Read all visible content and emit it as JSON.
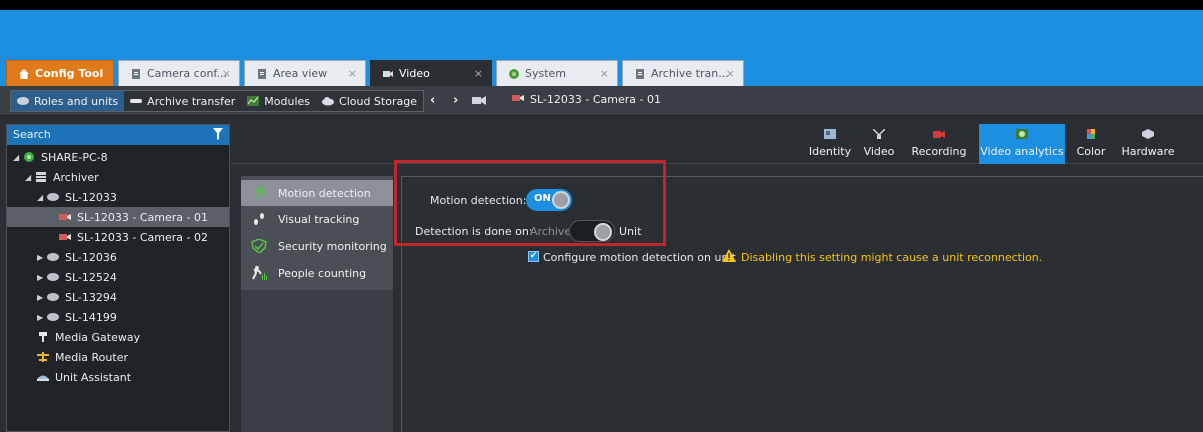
{
  "tabs": [
    {
      "label": "Config Tool",
      "icon": "home-icon"
    },
    {
      "label": "Camera conf...",
      "icon": "document-icon"
    },
    {
      "label": "Area view",
      "icon": "document-icon"
    },
    {
      "label": "Video",
      "icon": "camera-icon"
    },
    {
      "label": "System",
      "icon": "globe-icon"
    },
    {
      "label": "Archive tran...",
      "icon": "document-icon"
    }
  ],
  "toolbar": {
    "items": [
      {
        "label": "Roles and units",
        "icon": "roles-icon"
      },
      {
        "label": "Archive transfer",
        "icon": "archive-icon"
      },
      {
        "label": "Modules",
        "icon": "modules-icon"
      },
      {
        "label": "Cloud Storage",
        "icon": "cloud-icon"
      }
    ],
    "breadcrumb": "SL-12033 - Camera - 01"
  },
  "search": {
    "label": "Search"
  },
  "tree": [
    {
      "label": "SHARE-PC-8",
      "arrow": "◢",
      "icon": "server-icon"
    },
    {
      "label": "Archiver",
      "arrow": "◢",
      "icon": "archiver-icon"
    },
    {
      "label": "SL-12033",
      "arrow": "◢",
      "icon": "unit-icon"
    },
    {
      "label": "SL-12033 - Camera - 01",
      "arrow": "",
      "icon": "camera-icon"
    },
    {
      "label": "SL-12033 - Camera - 02",
      "arrow": "",
      "icon": "camera-icon"
    },
    {
      "label": "SL-12036",
      "arrow": "▶",
      "icon": "unit-icon"
    },
    {
      "label": "SL-12524",
      "arrow": "▶",
      "icon": "unit-icon"
    },
    {
      "label": "SL-13294",
      "arrow": "▶",
      "icon": "unit-icon"
    },
    {
      "label": "SL-14199",
      "arrow": "▶",
      "icon": "unit-icon"
    },
    {
      "label": "Media Gateway",
      "arrow": "",
      "icon": "gateway-icon"
    },
    {
      "label": "Media Router",
      "arrow": "",
      "icon": "router-icon"
    },
    {
      "label": "Unit Assistant",
      "arrow": "",
      "icon": "assistant-icon"
    }
  ],
  "ribbon": [
    {
      "label": "Identity"
    },
    {
      "label": "Video"
    },
    {
      "label": "Recording"
    },
    {
      "label": "Video analytics"
    },
    {
      "label": "Color"
    },
    {
      "label": "Hardware"
    }
  ],
  "sidenav": [
    {
      "label": "Motion detection",
      "icon": "motion-icon"
    },
    {
      "label": "Visual tracking",
      "icon": "tracking-icon"
    },
    {
      "label": "Security monitoring",
      "icon": "security-icon"
    },
    {
      "label": "People counting",
      "icon": "people-icon"
    }
  ],
  "settings": {
    "motion_label": "Motion detection:",
    "motion_state": "ON",
    "detection_label": "Detection is done on:",
    "option_archiver": "Archiver",
    "option_unit": "Unit",
    "configure_label": "Configure motion detection on unit",
    "warning": "Disabling this setting might cause a unit reconnection."
  },
  "colors": {
    "accent": "#1c8fe0",
    "home_tab": "#e07a1a",
    "warning": "#f5c518",
    "highlight": "#c0272d"
  }
}
